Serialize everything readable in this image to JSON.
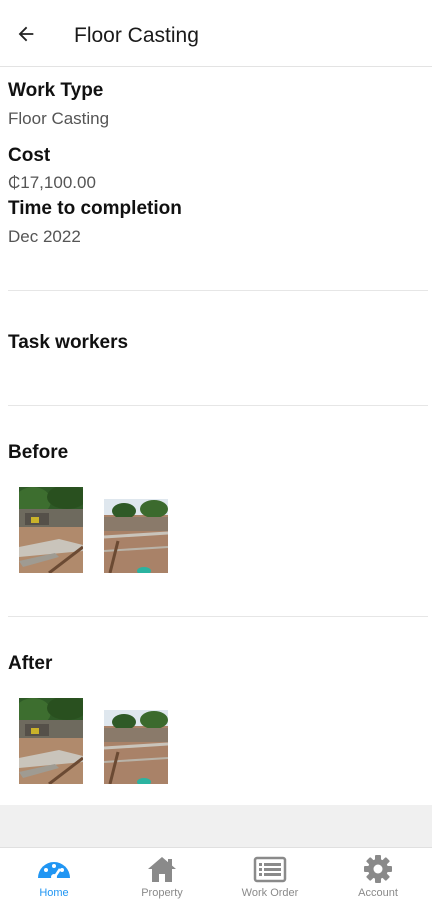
{
  "appbar": {
    "title": "Floor Casting"
  },
  "details": {
    "work_type_label": "Work Type",
    "work_type_value": "Floor Casting",
    "cost_label": "Cost",
    "cost_value": "₵17,100.00",
    "time_label": "Time to completion",
    "time_value": "Dec 2022"
  },
  "sections": {
    "task_workers": "Task workers",
    "before": "Before",
    "after": "After"
  },
  "nav": {
    "items": [
      {
        "label": "Home",
        "icon": "dashboard-icon",
        "active": true
      },
      {
        "label": "Property",
        "icon": "home-icon",
        "active": false
      },
      {
        "label": "Work Order",
        "icon": "list-icon",
        "active": false
      },
      {
        "label": "Account",
        "icon": "gear-icon",
        "active": false
      }
    ]
  },
  "colors": {
    "accent": "#2196f3",
    "inactive": "#8a8a8a"
  }
}
